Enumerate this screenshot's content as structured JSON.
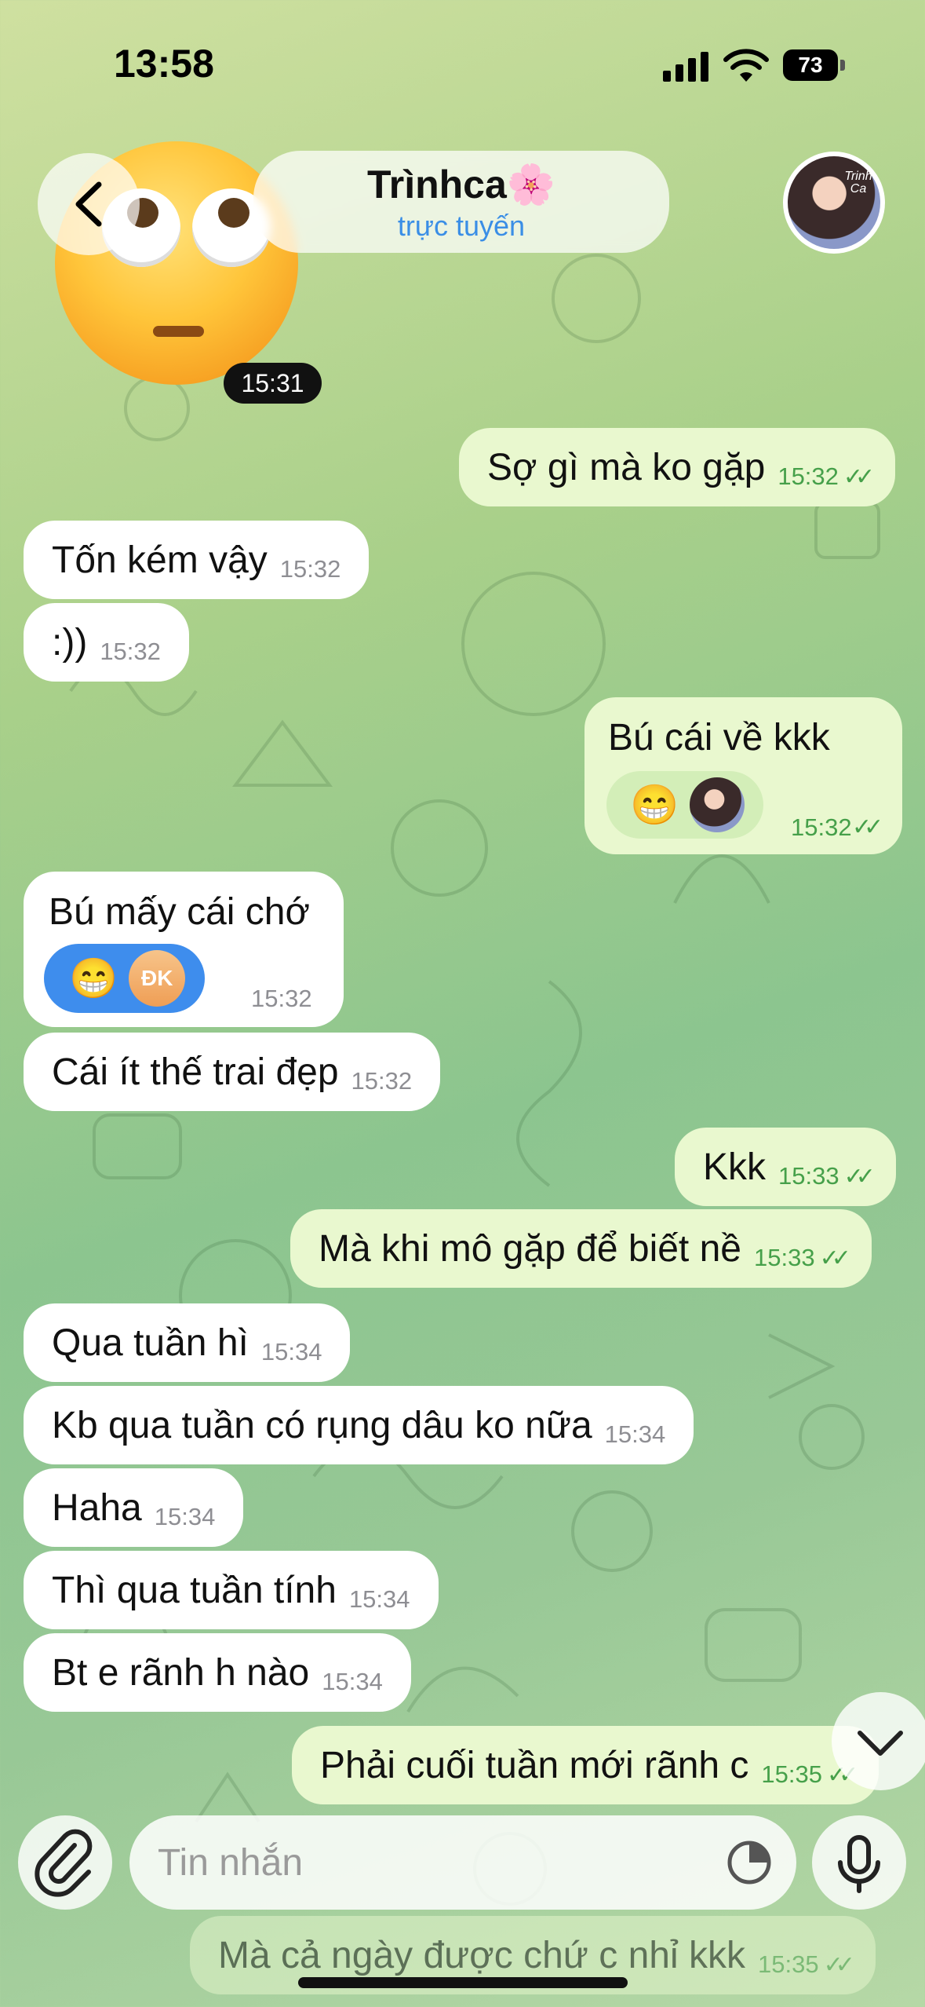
{
  "status_bar": {
    "time": "13:58",
    "battery": "73"
  },
  "header": {
    "name": "Trìnhca🌸",
    "status": "trực tuyến",
    "avatar_text": "Trinh Ca"
  },
  "sticker_time": "15:31",
  "messages": [
    {
      "dir": "out",
      "text": "Sợ gì mà ko gặp",
      "time": "15:32"
    },
    {
      "dir": "in",
      "text": "Tốn kém vậy",
      "time": "15:32"
    },
    {
      "dir": "in",
      "text": ":))",
      "time": "15:32"
    },
    {
      "dir": "out",
      "text": "Bú cái về kkk",
      "time": "15:32",
      "reaction": "😁"
    },
    {
      "dir": "in",
      "text": "Bú mấy cái chớ",
      "time": "15:32",
      "reaction": "😁",
      "reactor": "ĐK"
    },
    {
      "dir": "in",
      "text": "Cái ít thế trai đẹp",
      "time": "15:32"
    },
    {
      "dir": "out",
      "text": "Kkk",
      "time": "15:33"
    },
    {
      "dir": "out",
      "text": "Mà khi mô gặp để biết nề",
      "time": "15:33"
    },
    {
      "dir": "in",
      "text": "Qua tuần hì",
      "time": "15:34"
    },
    {
      "dir": "in",
      "text": "Kb qua tuần có rụng dâu ko nữa",
      "time": "15:34"
    },
    {
      "dir": "in",
      "text": "Haha",
      "time": "15:34"
    },
    {
      "dir": "in",
      "text": "Thì qua tuần tính",
      "time": "15:34"
    },
    {
      "dir": "in",
      "text": "Bt e rãnh h nào",
      "time": "15:34"
    },
    {
      "dir": "out",
      "text": "Phải cuối tuần mới rãnh c",
      "time": "15:35"
    },
    {
      "dir": "out",
      "text": "Mà cả ngày được chứ c nhỉ kkk",
      "time": "15:35"
    }
  ],
  "input": {
    "placeholder": "Tin nhắn"
  },
  "icons": {
    "back": "chevron-left-icon",
    "attach": "paperclip-icon",
    "sticker": "sticker-icon",
    "mic": "microphone-icon",
    "scroll": "chevron-down-icon"
  }
}
